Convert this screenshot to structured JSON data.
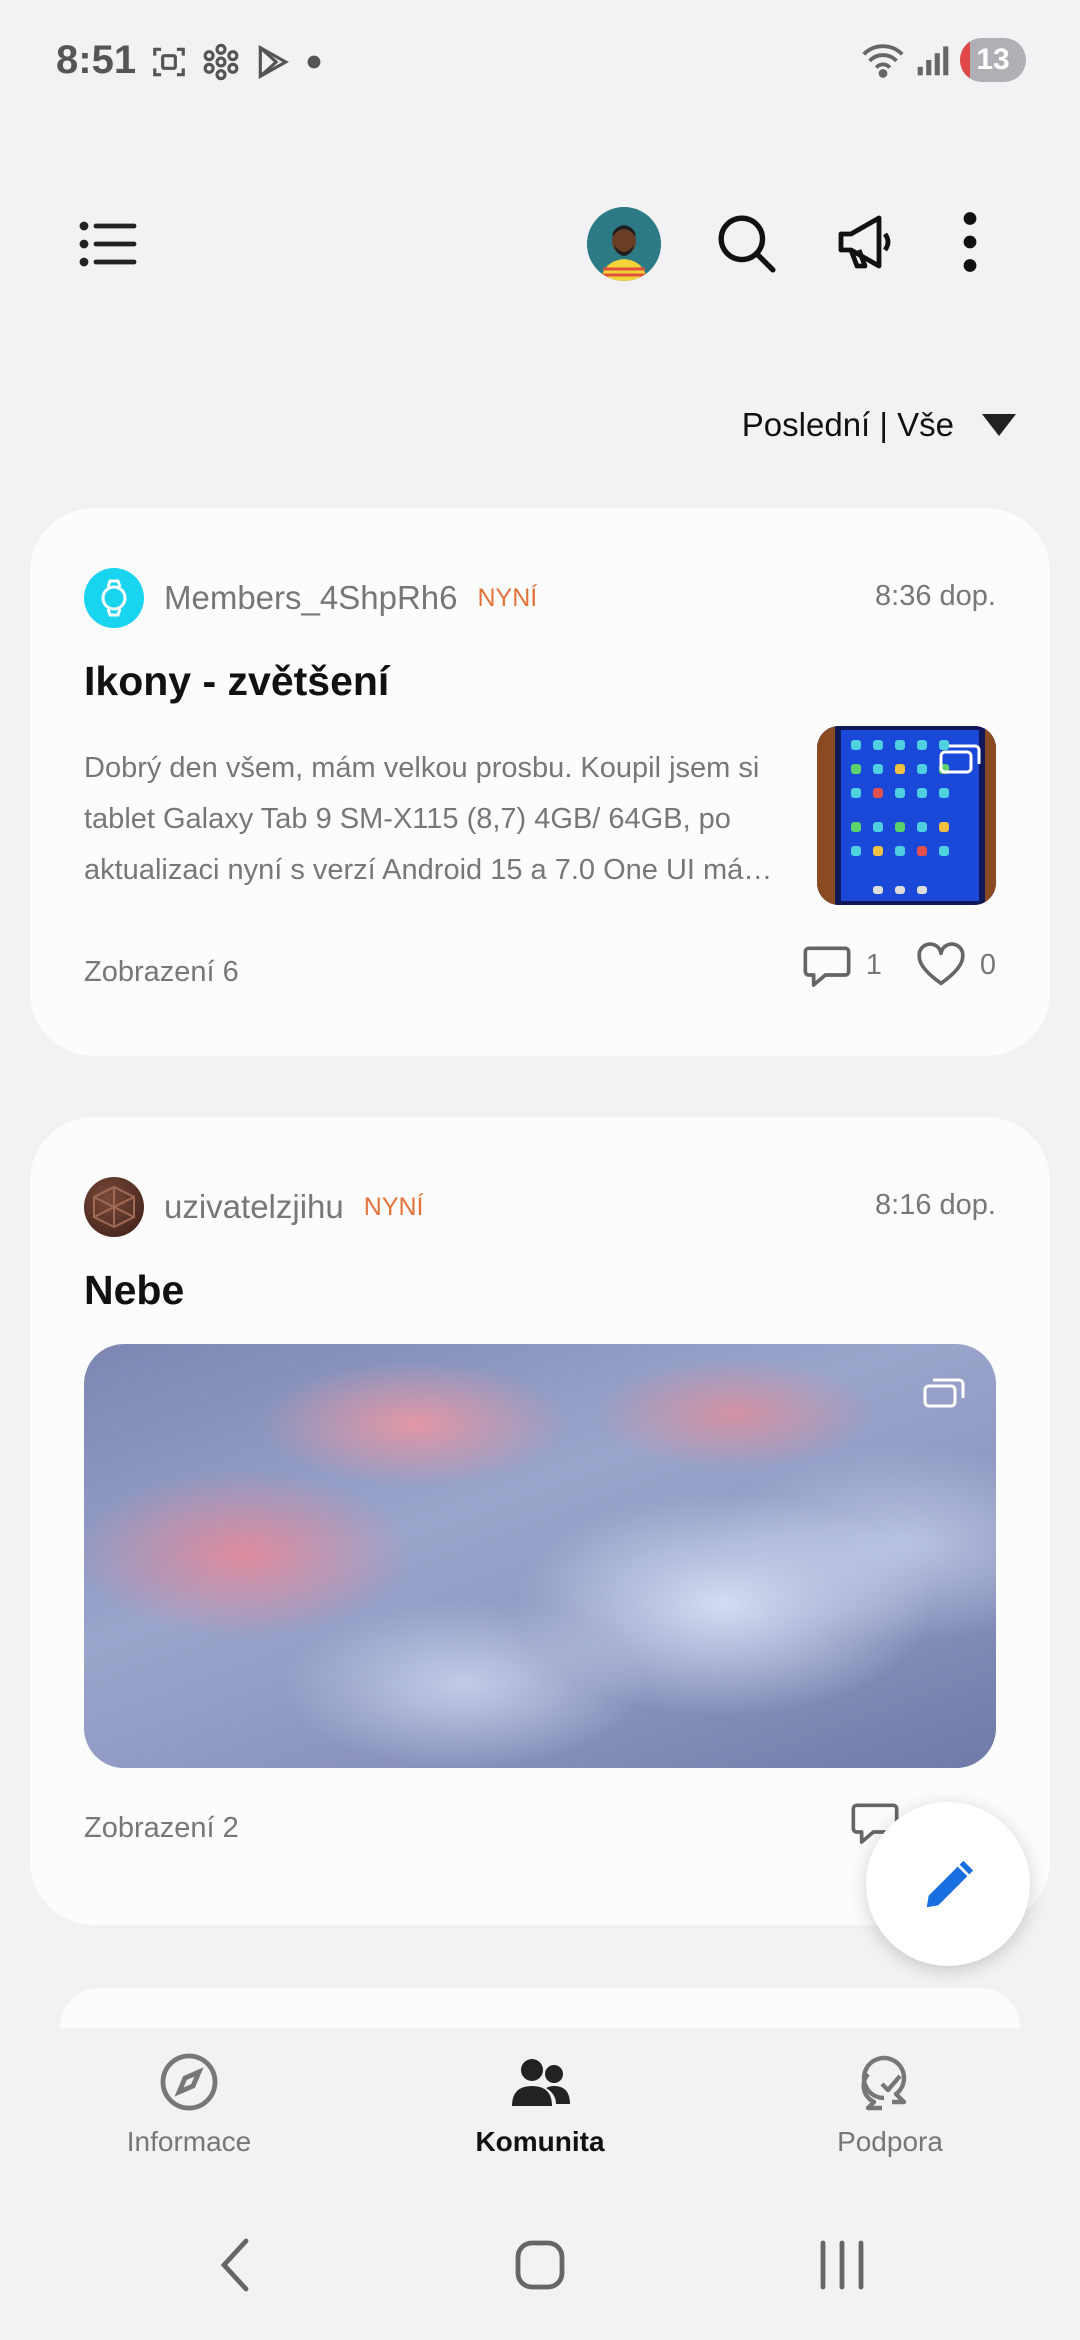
{
  "status_bar": {
    "time": "8:51",
    "battery": "13",
    "icons": [
      "screenshot-icon",
      "flower-icon",
      "play-store-icon",
      "dot-icon",
      "wifi-icon",
      "signal-icon",
      "battery-icon"
    ]
  },
  "appbar": {
    "icons": [
      "menu-icon",
      "avatar",
      "search-icon",
      "megaphone-icon",
      "more-vert-icon"
    ]
  },
  "filter": {
    "label": "Poslední | Vše"
  },
  "posts": [
    {
      "author": "Members_4ShpRh6",
      "badge": "NYNÍ",
      "time": "8:36 dop.",
      "title": "Ikony - zvětšení",
      "excerpt": "Dobrý den všem, mám velkou prosbu. Koupil jsem si tablet Galaxy Tab 9 SM-X115 (8,7) 4GB/ 64GB, po aktualizaci nyní s verzí Android 15 a 7.0 One UI mám na ploše hrozně malé ikony aplikací.",
      "views": "Zobrazení 6",
      "comments": "1",
      "likes": "0",
      "avatar_color": "#19d4ee"
    },
    {
      "author": "uzivatelzjihu",
      "badge": "NYNÍ",
      "time": "8:16 dop.",
      "title": "Nebe",
      "views": "Zobrazení 2",
      "comments": "0",
      "avatar_color": "#4a2a22"
    }
  ],
  "bottom_nav": [
    {
      "label": "Informace",
      "icon": "compass-icon",
      "active": false
    },
    {
      "label": "Komunita",
      "icon": "people-icon",
      "active": true
    },
    {
      "label": "Podpora",
      "icon": "support-chat-icon",
      "active": false
    }
  ],
  "colors": {
    "background": "#f2f2f4",
    "card": "#fcfcfd",
    "badge": "#e2733a",
    "fab_icon": "#1a6fe0"
  }
}
